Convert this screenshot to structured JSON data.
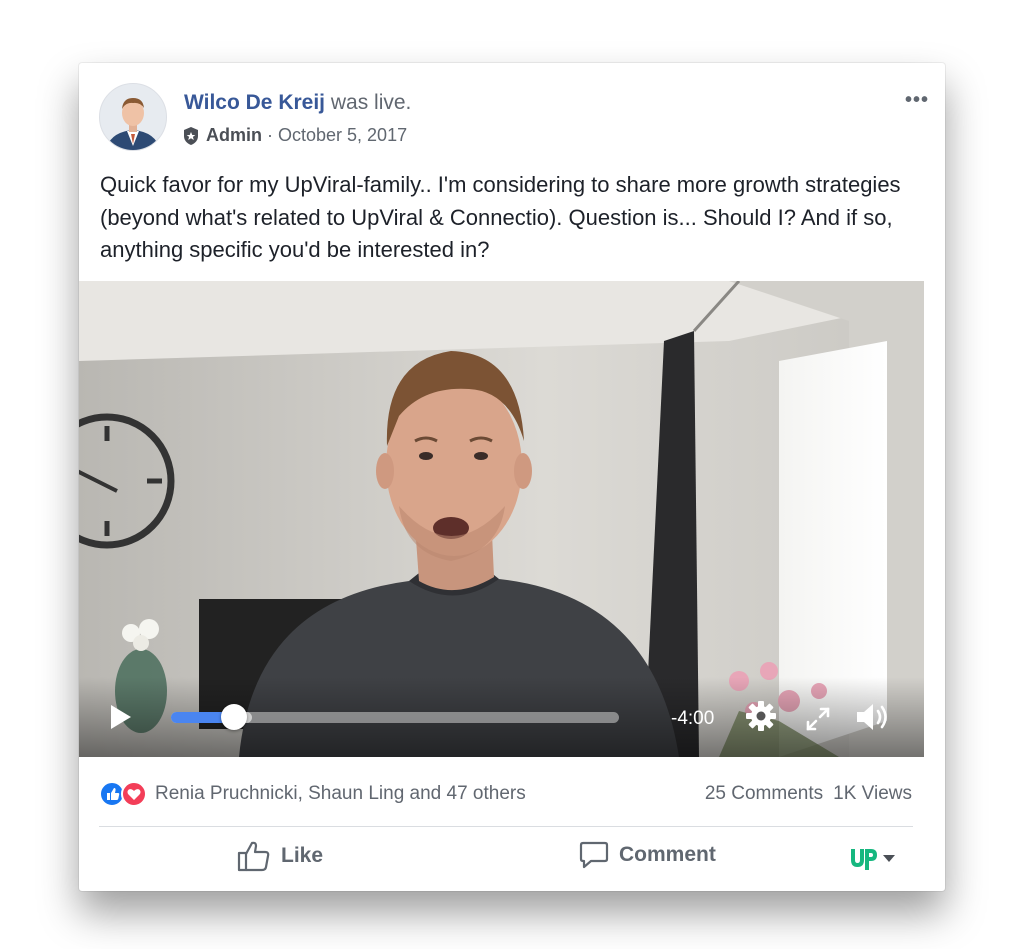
{
  "post": {
    "author": "Wilco De Kreij",
    "status": " was live.",
    "role": "Admin",
    "date": "October 5, 2017",
    "more_label": "•••",
    "text": "Quick favor for my UpViral-family.. I'm considering to share more growth strategies (beyond what's related to UpViral & Connectio). Question is... Should I? And if so, anything specific you'd be interested in?"
  },
  "video": {
    "time_remaining": "-4:00",
    "progress": 0.14,
    "buffered": 0.18,
    "icons": [
      "play-icon",
      "settings-gear-icon",
      "fullscreen-icon",
      "volume-icon"
    ]
  },
  "engagement": {
    "reactions_text": "Renia Pruchnicki, Shaun Ling and 47 others",
    "comments": "25 Comments",
    "views": "1K Views"
  },
  "actions": {
    "like": "Like",
    "comment": "Comment"
  },
  "colors": {
    "author": "#385898",
    "like_blue": "#1877f2",
    "love_red": "#f33e58",
    "progress_blue": "#4a85f0",
    "brand_teal": "#16b77f"
  }
}
